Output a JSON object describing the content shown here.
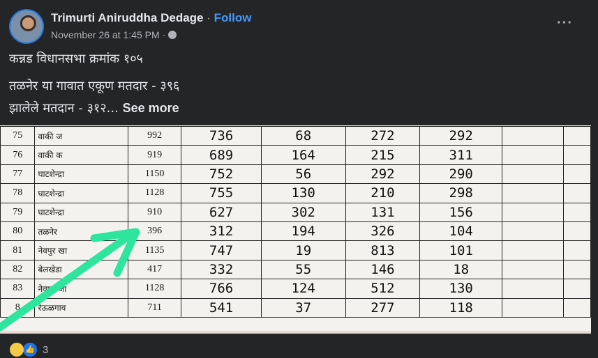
{
  "post": {
    "author": "Trimurti Aniruddha Dedage",
    "separator": "·",
    "follow_label": "Follow",
    "timestamp": "November 26 at 1:45 PM",
    "audience_icon": "globe-icon",
    "more_icon": "more-horizontal-icon",
    "lines": [
      "कन्नड विधानसभा क्रमांक १०५",
      "तळनेर या गावात एकूण मतदार - ३९६",
      "झालेले मतदान - ३१२..."
    ],
    "see_more_label": "See more"
  },
  "photo": {
    "rows": [
      {
        "no": "75",
        "village": "वाकी ज",
        "total": "992",
        "voted": "736",
        "c5": "68",
        "c6": "272",
        "c7": "292"
      },
      {
        "no": "76",
        "village": "वाकी क",
        "total": "919",
        "voted": "689",
        "c5": "164",
        "c6": "215",
        "c7": "311"
      },
      {
        "no": "77",
        "village": "घाटशेन्द्रा",
        "total": "1150",
        "voted": "752",
        "c5": "56",
        "c6": "292",
        "c7": "290"
      },
      {
        "no": "78",
        "village": "घाटशेन्द्रा",
        "total": "1128",
        "voted": "755",
        "c5": "130",
        "c6": "210",
        "c7": "298"
      },
      {
        "no": "79",
        "village": "घाटशेन्द्रा",
        "total": "910",
        "voted": "627",
        "c5": "302",
        "c6": "131",
        "c7": "156"
      },
      {
        "no": "80",
        "village": "तळनेर",
        "total": "396",
        "voted": "312",
        "c5": "194",
        "c6": "326",
        "c7": "104"
      },
      {
        "no": "81",
        "village": "नेवपुर खा",
        "total": "1135",
        "voted": "747",
        "c5": "19",
        "c6": "813",
        "c7": "101"
      },
      {
        "no": "82",
        "village": "बेलखेडा",
        "total": "417",
        "voted": "332",
        "c5": "55",
        "c6": "146",
        "c7": "18"
      },
      {
        "no": "83",
        "village": "नेवपुर जा",
        "total": "1128",
        "voted": "766",
        "c5": "124",
        "c6": "512",
        "c7": "130"
      },
      {
        "no": "8",
        "village": "रेऊळगाव",
        "total": "711",
        "voted": "541",
        "c5": "37",
        "c6": "277",
        "c7": "118"
      }
    ],
    "arrow_color": "#2ee59d"
  },
  "reactions": {
    "icons": [
      "wow-reaction-icon",
      "like-reaction-icon"
    ],
    "count": "3"
  }
}
